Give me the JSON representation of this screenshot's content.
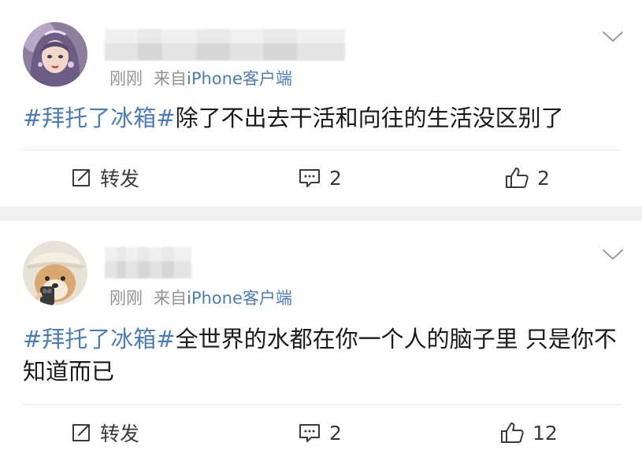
{
  "posts": [
    {
      "meta_time": "刚刚",
      "meta_source_prefix": "来自",
      "meta_client": "iPhone客户端",
      "topic": "#拜托了冰箱#",
      "text": "除了不出去干活和向往的生活没区别了",
      "repost_label": "转发",
      "comment_count": "2",
      "like_count": "2",
      "avatar": "anime-girl-avatar"
    },
    {
      "meta_time": "刚刚",
      "meta_source_prefix": "来自",
      "meta_client": "iPhone客户端",
      "topic": "#拜托了冰箱#",
      "text": "全世界的水都在你一个人的脑子里 只是你不知道而已",
      "repost_label": "转发",
      "comment_count": "2",
      "like_count": "12",
      "avatar": "shiba-dog-avatar"
    }
  ],
  "icons": {
    "repost": "edit-share-icon",
    "comment": "comment-icon",
    "like": "thumbs-up-icon",
    "menu": "chevron-down-icon"
  },
  "colors": {
    "topic_link": "#4f7db3",
    "meta_gray": "#939393",
    "divider": "#f0f0f2"
  }
}
